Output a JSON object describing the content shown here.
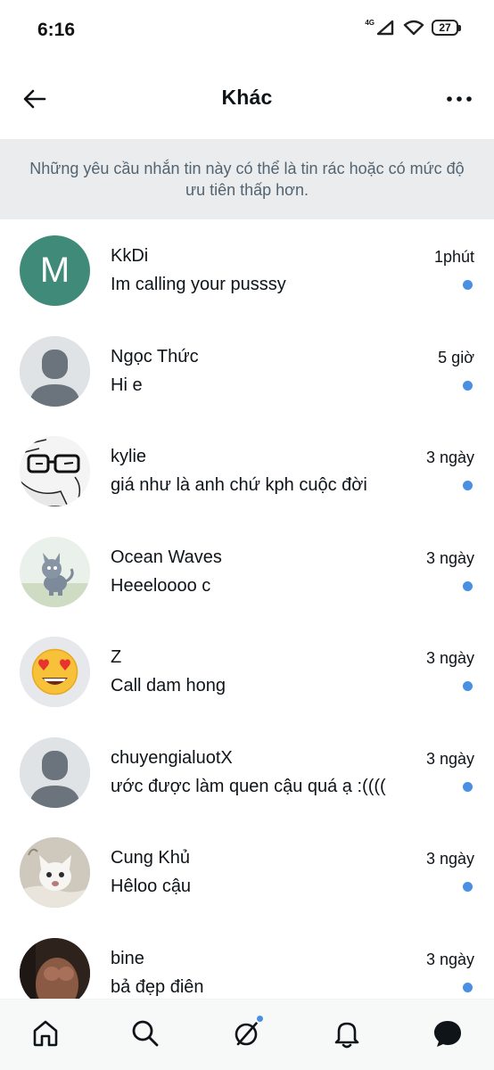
{
  "status": {
    "time": "6:16",
    "network": "4G",
    "battery": "27"
  },
  "header": {
    "title": "Khác"
  },
  "notice": {
    "text": "Những yêu cầu nhắn tin này có thể là tin rác hoặc có mức độ ưu tiên thấp hơn."
  },
  "conversations": [
    {
      "name": "KkDi",
      "message": "Im calling your pusssy",
      "time": "1phút",
      "avatar_letter": "M",
      "unread": true
    },
    {
      "name": "Ngọc Thức",
      "message": "Hi e",
      "time": "5 giờ",
      "unread": true
    },
    {
      "name": "kylie",
      "message": "giá như là anh chứ kph cuộc đời",
      "time": "3 ngày",
      "unread": true
    },
    {
      "name": "Ocean Waves",
      "message": "Heeeloooo c",
      "time": "3 ngày",
      "unread": true
    },
    {
      "name": "Z",
      "message": "Call dam hong",
      "time": "3 ngày",
      "unread": true
    },
    {
      "name": "chuyengialuotX",
      "message": "ước được làm quen cậu quá ạ :((((",
      "time": "3 ngày",
      "unread": true
    },
    {
      "name": "Cung Khủ",
      "message": "Hêloo cậu",
      "time": "3 ngày",
      "unread": true
    },
    {
      "name": "bine",
      "message": "bả đẹp điên",
      "time": "3 ngày",
      "unread": true
    }
  ],
  "colors": {
    "accent_dot": "#4a90e2",
    "letter_avatar": "#3f8a78",
    "notice_bg": "#eaecee"
  },
  "tabs": [
    "home-icon",
    "search-icon",
    "grok-icon",
    "bell-icon",
    "messages-icon"
  ]
}
